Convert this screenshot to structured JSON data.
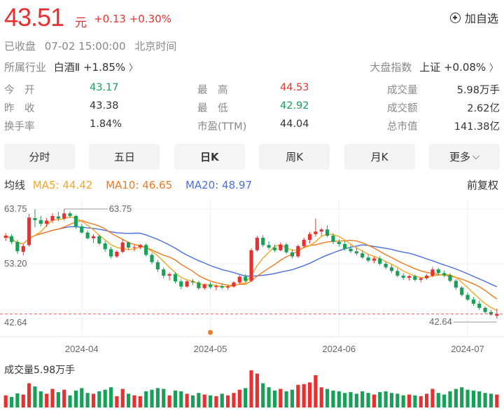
{
  "quote": {
    "price": "43.51",
    "currency": "元",
    "change": "+0.13 +0.30%",
    "status": "已收盘",
    "datetime": "07-02 15:00:00",
    "timezone": "北京时间",
    "add_watch": "加自选"
  },
  "industry": {
    "label": "所属行业",
    "name": "白酒Ⅱ",
    "change": "+1.85%"
  },
  "market_index": {
    "label": "大盘指数",
    "name": "上证",
    "change": "+0.08%"
  },
  "stats": [
    [
      {
        "k": "今　开",
        "v": "43.17",
        "c": "down"
      },
      {
        "k": "最　高",
        "v": "44.53",
        "c": "up"
      },
      {
        "k": "成交量",
        "v": "5.98万手",
        "c": "n"
      }
    ],
    [
      {
        "k": "昨　收",
        "v": "43.38",
        "c": "n"
      },
      {
        "k": "最　低",
        "v": "42.92",
        "c": "down"
      },
      {
        "k": "成交额",
        "v": "2.62亿",
        "c": "n"
      }
    ],
    [
      {
        "k": "换手率",
        "v": "1.84%",
        "c": "n"
      },
      {
        "k": "市盈(TTM)",
        "v": "44.04",
        "c": "n"
      },
      {
        "k": "总市值",
        "v": "141.38亿",
        "c": "n"
      }
    ]
  ],
  "tabs": [
    "分时",
    "五日",
    "日K",
    "周K",
    "月K",
    "更多"
  ],
  "active_tab": "日K",
  "ma": {
    "label": "均线",
    "ma5": "MA5: 44.42",
    "ma10": "MA10: 46.65",
    "ma20": "MA20: 48.97",
    "adjust": "前复权"
  },
  "colors": {
    "up": "#e93030",
    "down": "#18a058",
    "ma5": "#f5a623",
    "ma10": "#f07a1f",
    "ma20": "#4a6ee0"
  },
  "chart_data": {
    "type": "candlestick",
    "y_ticks": [
      "63.75",
      "53.20",
      "42.64"
    ],
    "x_labels": [
      "2024-04",
      "2024-05",
      "2024-06",
      "2024-07"
    ],
    "x_label_index": [
      13,
      35,
      57,
      79
    ],
    "max_label": "63.75",
    "min_label": "42.64",
    "ylim": [
      40.5,
      65.5
    ],
    "candles": [
      [
        58.2,
        59.1,
        57.6,
        58.6
      ],
      [
        58.5,
        58.9,
        57.0,
        57.4
      ],
      [
        57.4,
        57.8,
        55.1,
        55.6
      ],
      [
        55.5,
        57.0,
        54.8,
        56.6
      ],
      [
        56.8,
        62.8,
        56.5,
        62.1
      ],
      [
        62.0,
        63.7,
        60.2,
        61.6
      ],
      [
        61.6,
        62.4,
        60.4,
        60.9
      ],
      [
        60.9,
        62.0,
        60.3,
        61.5
      ],
      [
        61.5,
        62.9,
        61.0,
        62.4
      ],
      [
        62.3,
        63.2,
        61.4,
        61.9
      ],
      [
        61.9,
        63.75,
        61.5,
        62.9
      ],
      [
        62.9,
        63.3,
        62.0,
        62.4
      ],
      [
        62.4,
        62.6,
        59.9,
        60.4
      ],
      [
        60.4,
        60.9,
        59.0,
        59.2
      ],
      [
        59.2,
        59.6,
        57.9,
        58.1
      ],
      [
        58.1,
        58.9,
        57.2,
        58.5
      ],
      [
        58.5,
        58.8,
        56.8,
        57.1
      ],
      [
        57.1,
        57.6,
        55.5,
        56.0
      ],
      [
        56.0,
        56.4,
        54.2,
        54.6
      ],
      [
        54.6,
        55.8,
        54.3,
        55.5
      ],
      [
        55.5,
        57.9,
        55.2,
        57.3
      ],
      [
        57.3,
        57.5,
        55.8,
        56.3
      ],
      [
        56.3,
        56.8,
        55.6,
        56.4
      ],
      [
        56.4,
        57.0,
        56.0,
        56.8
      ],
      [
        56.8,
        57.1,
        54.6,
        54.9
      ],
      [
        54.9,
        55.3,
        53.1,
        53.5
      ],
      [
        53.5,
        53.9,
        51.6,
        52.1
      ],
      [
        52.1,
        52.5,
        50.4,
        50.9
      ],
      [
        50.9,
        51.5,
        50.0,
        51.2
      ],
      [
        51.2,
        51.6,
        49.4,
        49.8
      ],
      [
        49.8,
        50.2,
        48.3,
        48.8
      ],
      [
        48.8,
        50.1,
        48.6,
        49.8
      ],
      [
        49.8,
        50.3,
        49.1,
        49.6
      ],
      [
        49.6,
        49.9,
        48.2,
        48.5
      ],
      [
        48.5,
        49.4,
        48.2,
        49.2
      ],
      [
        49.2,
        49.6,
        48.4,
        48.7
      ],
      [
        48.7,
        49.2,
        48.1,
        48.9
      ],
      [
        48.9,
        49.3,
        48.3,
        48.6
      ],
      [
        48.6,
        49.1,
        48.2,
        48.8
      ],
      [
        48.8,
        49.8,
        48.6,
        49.6
      ],
      [
        49.6,
        51.0,
        49.3,
        50.7
      ],
      [
        50.7,
        51.2,
        49.6,
        49.9
      ],
      [
        49.9,
        56.2,
        49.7,
        55.8
      ],
      [
        55.8,
        58.6,
        55.5,
        58.2
      ],
      [
        58.2,
        58.7,
        56.4,
        56.8
      ],
      [
        56.8,
        57.5,
        55.9,
        56.3
      ],
      [
        56.3,
        56.9,
        55.4,
        55.8
      ],
      [
        55.8,
        57.3,
        55.6,
        56.9
      ],
      [
        56.9,
        57.2,
        55.1,
        55.4
      ],
      [
        55.4,
        56.0,
        54.2,
        54.6
      ],
      [
        54.6,
        56.9,
        54.3,
        56.6
      ],
      [
        56.6,
        58.2,
        56.3,
        57.8
      ],
      [
        57.8,
        59.3,
        57.1,
        58.9
      ],
      [
        58.9,
        61.9,
        58.4,
        59.4
      ],
      [
        59.4,
        60.1,
        58.6,
        59.8
      ],
      [
        59.8,
        60.6,
        58.3,
        58.6
      ],
      [
        58.6,
        59.1,
        57.0,
        57.4
      ],
      [
        57.4,
        57.9,
        56.5,
        57.0
      ],
      [
        57.0,
        57.6,
        55.7,
        56.1
      ],
      [
        56.1,
        56.8,
        55.3,
        55.6
      ],
      [
        55.6,
        56.3,
        54.8,
        55.2
      ],
      [
        55.2,
        55.7,
        54.1,
        54.4
      ],
      [
        54.4,
        54.9,
        53.5,
        53.8
      ],
      [
        53.8,
        54.6,
        53.3,
        54.2
      ],
      [
        54.2,
        54.6,
        52.9,
        53.2
      ],
      [
        53.2,
        53.6,
        52.1,
        52.5
      ],
      [
        52.5,
        53.0,
        51.4,
        51.8
      ],
      [
        51.8,
        52.3,
        50.6,
        50.9
      ],
      [
        50.9,
        51.4,
        50.1,
        50.5
      ],
      [
        50.5,
        51.0,
        50.0,
        50.8
      ],
      [
        50.8,
        51.1,
        49.8,
        50.1
      ],
      [
        50.1,
        50.6,
        49.6,
        50.4
      ],
      [
        50.4,
        51.2,
        50.1,
        50.9
      ],
      [
        50.9,
        52.6,
        50.6,
        52.1
      ],
      [
        52.1,
        52.4,
        51.0,
        51.4
      ],
      [
        51.4,
        51.9,
        50.6,
        51.0
      ],
      [
        51.0,
        51.4,
        49.6,
        49.9
      ],
      [
        49.9,
        50.3,
        48.2,
        48.6
      ],
      [
        48.6,
        48.9,
        46.9,
        47.2
      ],
      [
        47.2,
        47.7,
        46.0,
        46.3
      ],
      [
        46.3,
        46.8,
        45.1,
        45.5
      ],
      [
        45.5,
        46.1,
        44.3,
        44.7
      ],
      [
        44.7,
        45.0,
        43.6,
        43.9
      ],
      [
        43.9,
        44.3,
        43.2,
        43.4
      ],
      [
        43.17,
        44.53,
        42.64,
        43.51
      ]
    ],
    "volumes": [
      30,
      26,
      35,
      32,
      60,
      52,
      40,
      34,
      46,
      38,
      44,
      30,
      42,
      48,
      36,
      34,
      40,
      44,
      50,
      28,
      46,
      34,
      30,
      28,
      40,
      44,
      48,
      46,
      30,
      42,
      40,
      34,
      30,
      36,
      32,
      30,
      28,
      34,
      30,
      36,
      44,
      48,
      92,
      84,
      60,
      50,
      42,
      46,
      40,
      44,
      56,
      58,
      62,
      80,
      50,
      46,
      42,
      40,
      36,
      38,
      34,
      40,
      36,
      32,
      38,
      40,
      36,
      34,
      30,
      32,
      30,
      28,
      34,
      46,
      36,
      32,
      40,
      46,
      50,
      44,
      42,
      40,
      36,
      34,
      32
    ],
    "ma5_end": 44.42,
    "ma10_end": 46.65,
    "ma20_end": 48.97
  },
  "volume": {
    "label": "成交量5.98万手"
  }
}
